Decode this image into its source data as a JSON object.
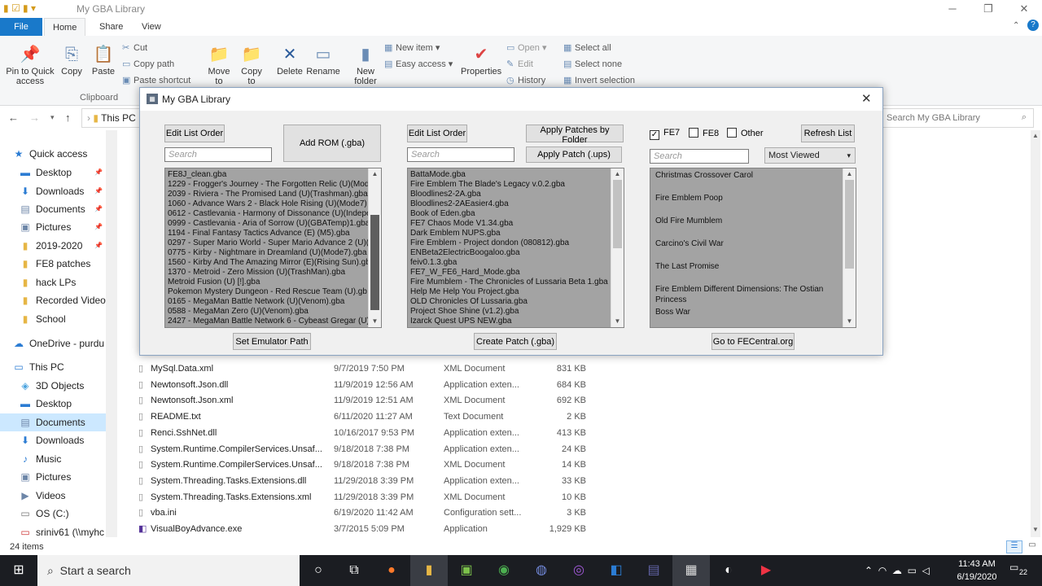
{
  "explorer": {
    "title": "My GBA Library",
    "tabs": [
      "File",
      "Home",
      "Share",
      "View"
    ],
    "ribbon": {
      "pin": "Pin to Quick access",
      "copy": "Copy",
      "paste": "Paste",
      "cut": "Cut",
      "copy_path": "Copy path",
      "paste_shortcut": "Paste shortcut",
      "clipboard": "Clipboard",
      "move_to": "Move to",
      "copy_to": "Copy to",
      "delete": "Delete",
      "rename": "Rename",
      "new_folder": "New folder",
      "new_item": "New item",
      "easy_access": "Easy access",
      "properties": "Properties",
      "open": "Open",
      "edit": "Edit",
      "history": "History",
      "select_all": "Select all",
      "select_none": "Select none",
      "invert_selection": "Invert selection"
    },
    "address": "This PC",
    "search_placeholder": "Search My GBA Library",
    "nav": [
      {
        "label": "Quick access",
        "icon": "star-icon"
      },
      {
        "label": "Desktop",
        "icon": "desktop-icon"
      },
      {
        "label": "Downloads",
        "icon": "download-icon"
      },
      {
        "label": "Documents",
        "icon": "documents-icon"
      },
      {
        "label": "Pictures",
        "icon": "pictures-icon"
      },
      {
        "label": "2019-2020",
        "icon": "folder-icon"
      },
      {
        "label": "FE8 patches",
        "icon": "folder-icon"
      },
      {
        "label": "hack LPs",
        "icon": "folder-icon"
      },
      {
        "label": "Recorded Videos",
        "icon": "folder-icon"
      },
      {
        "label": "School",
        "icon": "folder-icon"
      },
      {
        "label": "OneDrive - purdu",
        "icon": "cloud-icon"
      },
      {
        "label": "This PC",
        "icon": "pc-icon"
      },
      {
        "label": "3D Objects",
        "icon": "cube-icon"
      },
      {
        "label": "Desktop",
        "icon": "desktop-icon"
      },
      {
        "label": "Documents",
        "icon": "documents-icon"
      },
      {
        "label": "Downloads",
        "icon": "download-icon"
      },
      {
        "label": "Music",
        "icon": "music-icon"
      },
      {
        "label": "Pictures",
        "icon": "pictures-icon"
      },
      {
        "label": "Videos",
        "icon": "videos-icon"
      },
      {
        "label": "OS (C:)",
        "icon": "drive-icon"
      },
      {
        "label": "sriniv61 (\\\\myhc",
        "icon": "network-drive-icon"
      }
    ],
    "files": [
      {
        "name": "MySql.Data.xml",
        "date": "9/7/2019 7:50 PM",
        "type": "XML Document",
        "size": "831 KB"
      },
      {
        "name": "Newtonsoft.Json.dll",
        "date": "11/9/2019 12:56 AM",
        "type": "Application exten...",
        "size": "684 KB"
      },
      {
        "name": "Newtonsoft.Json.xml",
        "date": "11/9/2019 12:51 AM",
        "type": "XML Document",
        "size": "692 KB"
      },
      {
        "name": "README.txt",
        "date": "6/11/2020 11:27 AM",
        "type": "Text Document",
        "size": "2 KB"
      },
      {
        "name": "Renci.SshNet.dll",
        "date": "10/16/2017 9:53 PM",
        "type": "Application exten...",
        "size": "413 KB"
      },
      {
        "name": "System.Runtime.CompilerServices.Unsaf...",
        "date": "9/18/2018 7:38 PM",
        "type": "Application exten...",
        "size": "24 KB"
      },
      {
        "name": "System.Runtime.CompilerServices.Unsaf...",
        "date": "9/18/2018 7:38 PM",
        "type": "XML Document",
        "size": "14 KB"
      },
      {
        "name": "System.Threading.Tasks.Extensions.dll",
        "date": "11/29/2018 3:39 PM",
        "type": "Application exten...",
        "size": "33 KB"
      },
      {
        "name": "System.Threading.Tasks.Extensions.xml",
        "date": "11/29/2018 3:39 PM",
        "type": "XML Document",
        "size": "10 KB"
      },
      {
        "name": "vba.ini",
        "date": "6/19/2020 11:42 AM",
        "type": "Configuration sett...",
        "size": "3 KB"
      },
      {
        "name": "VisualBoyAdvance.exe",
        "date": "3/7/2015 5:09 PM",
        "type": "Application",
        "size": "1,929 KB"
      }
    ],
    "status": "24 items"
  },
  "dialog": {
    "title": "My GBA Library",
    "col1": {
      "edit_list_order": "Edit List Order",
      "add_rom": "Add ROM (.gba)",
      "search_placeholder": "Search",
      "items": [
        "FE8J_clean.gba",
        "1229 - Frogger's Journey - The Forgotten Relic (U)(Mode",
        "2039 - Riviera - The Promised Land (U)(Trashman).gba",
        "1060 - Advance Wars 2 - Black Hole Rising (U)(Mode7)",
        "0612 - Castlevania - Harmony of Dissonance (U)(Indepe",
        "0999 - Castlevania - Aria of Sorrow (U)(GBATemp)1.gba",
        "1194 - Final Fantasy Tactics Advance (E) (M5).gba",
        "0297 - Super Mario World - Super Mario Advance 2 (U)(",
        "0775 - Kirby - Nightmare in Dreamland (U)(Mode7).gba",
        "1560 - Kirby And The Amazing Mirror (E)(Rising Sun).gba",
        "1370 - Metroid - Zero Mission (U)(TrashMan).gba",
        "Metroid Fusion (U) [!].gba",
        "Pokemon Mystery Dungeon - Red Rescue Team (U).gb",
        "0165 - MegaMan Battle Network (U)(Venom).gba",
        "0588 - MegaMan Zero (U)(Venom).gba",
        "2427 - MegaMan Battle Network 6 - Cybeast Gregar (U)"
      ],
      "set_emulator_path": "Set Emulator Path"
    },
    "col2": {
      "edit_list_order": "Edit List Order",
      "apply_by_folder": "Apply Patches by Folder",
      "apply_patch": "Apply Patch (.ups)",
      "search_placeholder": "Search",
      "items": [
        "BattaMode.gba",
        "Fire Emblem The Blade's Legacy v.0.2.gba",
        "Bloodlines2-2A.gba",
        "Bloodlines2-2AEasier4.gba",
        "Book of Eden.gba",
        "FE7 Chaos Mode V1.34.gba",
        "Dark Emblem NUPS.gba",
        "Fire Emblem - Project dondon (080812).gba",
        "ENBeta2ElectricBoogaloo.gba",
        "feiv0.1.3.gba",
        "FE7_W_FE6_Hard_Mode.gba",
        "Fire Mumblem - The Chronicles of Lussaria Beta 1.gba",
        "Help Me Help You Project.gba",
        "OLD Chronicles Of Lussaria.gba",
        "Project Shoe Shine (v1.2).gba",
        "Izarck Quest UPS NEW.gba"
      ],
      "create_patch": "Create Patch (.gba)"
    },
    "col3": {
      "fe7": "FE7",
      "fe8": "FE8",
      "other": "Other",
      "refresh": "Refresh List",
      "search_placeholder": "Search",
      "sort": "Most Viewed",
      "items": [
        "Christmas Crossover Carol",
        "Fire Emblem Poop",
        "Old Fire Mumblem",
        "Carcino's Civil War",
        "The Last Promise",
        "Fire Emblem Different Dimensions: The Ostian Princess",
        "Boss War"
      ],
      "go_fecentral": "Go to FECentral.org"
    }
  },
  "taskbar": {
    "search_placeholder": "Start a search",
    "time": "11:43 AM",
    "date": "6/19/2020",
    "notifications": "22"
  }
}
